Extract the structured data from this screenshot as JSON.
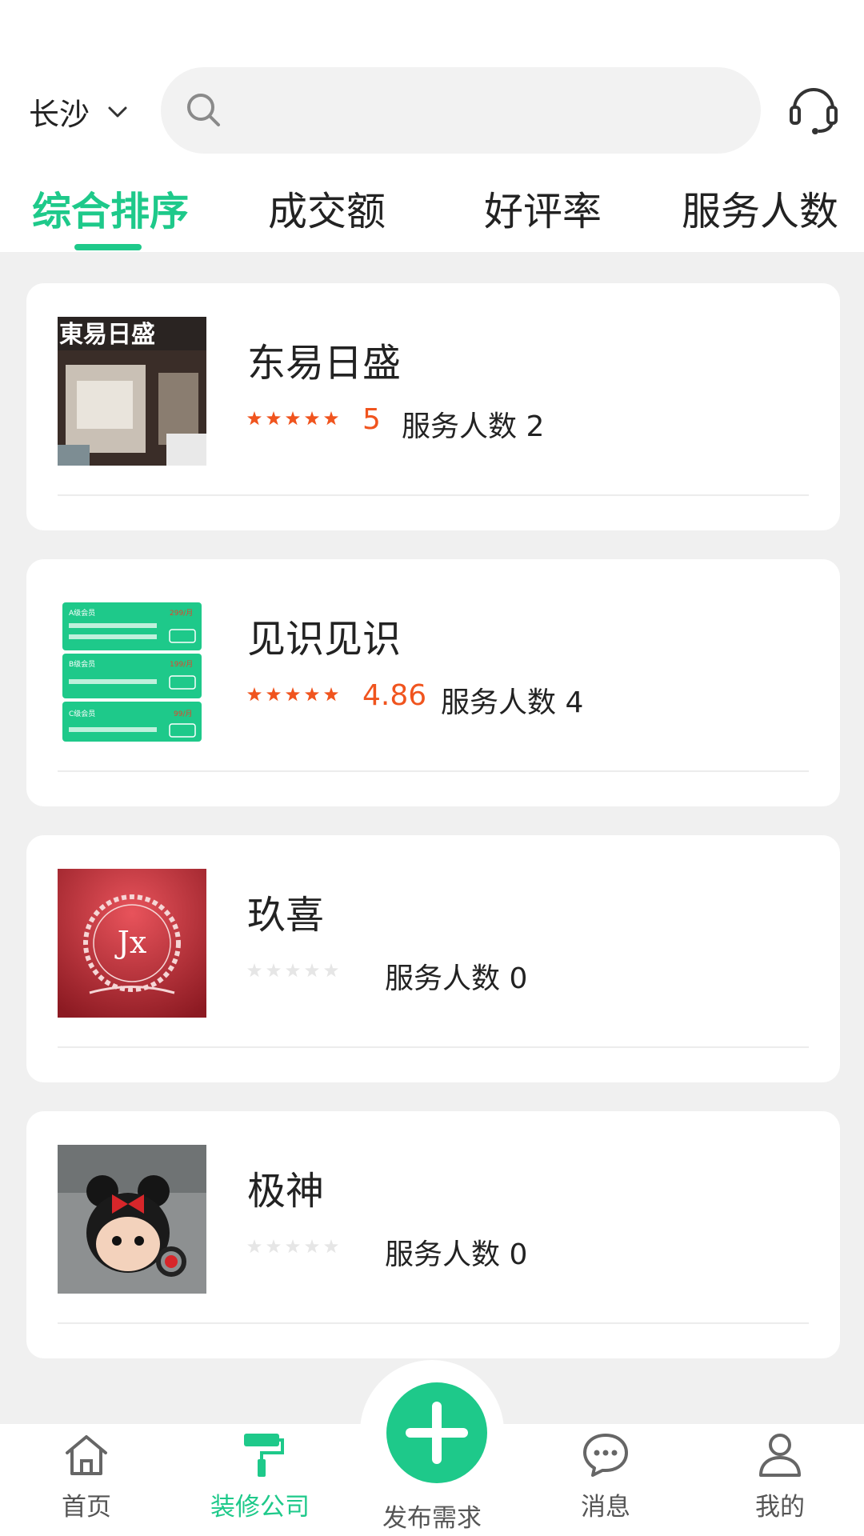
{
  "header": {
    "city": "长沙",
    "search_placeholder": ""
  },
  "tabs": [
    {
      "label": "综合排序",
      "active": true
    },
    {
      "label": "成交额",
      "active": false
    },
    {
      "label": "好评率",
      "active": false
    },
    {
      "label": "服务人数",
      "active": false
    }
  ],
  "companies": [
    {
      "name": "东易日盛",
      "rating": 5,
      "rating_text": "5",
      "served_label": "服务人数 2",
      "image": "storefront-photo",
      "sign_text": "東易日盛"
    },
    {
      "name": "见识见识",
      "rating": 4.86,
      "rating_text": "4.86",
      "served_label": "服务人数 4",
      "image": "membership-plans-screenshot",
      "plans": [
        {
          "name": "A级会员",
          "price": "299/月"
        },
        {
          "name": "B级会员",
          "price": "199/月"
        },
        {
          "name": "C级会员",
          "price": "99/月"
        }
      ]
    },
    {
      "name": "玖喜",
      "rating": 0,
      "rating_text": "",
      "served_label": "服务人数 0",
      "image": "jx-logo",
      "logo_text": "Jx"
    },
    {
      "name": "极神",
      "rating": 0,
      "rating_text": "",
      "served_label": "服务人数 0",
      "image": "minnie-earbud-case-photo"
    }
  ],
  "bottom_nav": [
    {
      "label": "首页",
      "icon": "home-icon",
      "active": false
    },
    {
      "label": "装修公司",
      "icon": "paint-roller-icon",
      "active": true
    },
    {
      "label": "发布需求",
      "icon": "plus-icon",
      "active": false
    },
    {
      "label": "消息",
      "icon": "chat-bubble-icon",
      "active": false
    },
    {
      "label": "我的",
      "icon": "user-icon",
      "active": false
    }
  ],
  "colors": {
    "accent": "#1ec98a",
    "rating": "#f0541e",
    "star_empty": "#e6e6e6"
  }
}
